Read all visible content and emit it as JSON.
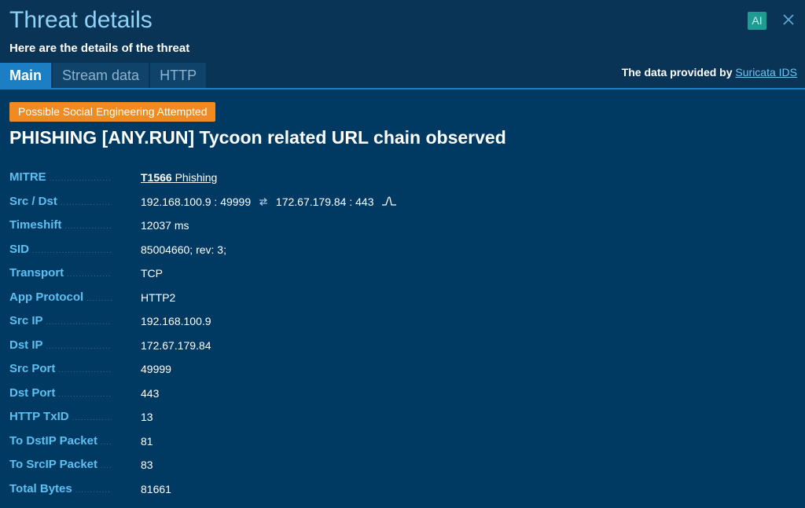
{
  "dialog": {
    "title": "Threat details",
    "subtitle": "Here are the details of the threat",
    "ai_label": "AI",
    "accent_color": "#1c7fc4",
    "header_color": "#8fd2f6"
  },
  "tabs": [
    {
      "label": "Main",
      "active": true
    },
    {
      "label": "Stream data",
      "active": false
    },
    {
      "label": "HTTP",
      "active": false
    }
  ],
  "provider": {
    "prefix": "The data provided by",
    "link": "Suricata IDS"
  },
  "threat": {
    "category_badge": "Possible Social Engineering Attempted",
    "badge_color": "#f18b1f",
    "name": "PHISHING [ANY.RUN] Tycoon related URL chain observed"
  },
  "details": {
    "mitre": {
      "label": "MITRE",
      "id": "T1566",
      "name": "Phishing"
    },
    "src_dst": {
      "label": "Src / Dst",
      "src": "192.168.100.9 : 49999",
      "dst": "172.67.179.84 : 443",
      "swap_icon": "swap-arrows-icon",
      "signal_icon": "signal-pulse-icon"
    },
    "timeshift": {
      "label": "Timeshift",
      "value": "12037 ms"
    },
    "sid": {
      "label": "SID",
      "value": "85004660; rev: 3;"
    },
    "transport": {
      "label": "Transport",
      "value": "TCP"
    },
    "app_protocol": {
      "label": "App Protocol",
      "value": "HTTP2"
    },
    "src_ip": {
      "label": "Src IP",
      "value": "192.168.100.9"
    },
    "dst_ip": {
      "label": "Dst IP",
      "value": "172.67.179.84"
    },
    "src_port": {
      "label": "Src Port",
      "value": "49999"
    },
    "dst_port": {
      "label": "Dst Port",
      "value": "443"
    },
    "http_txid": {
      "label": "HTTP TxID",
      "value": "13"
    },
    "to_dstip_packet": {
      "label": "To DstIP Packet",
      "value": "81"
    },
    "to_srcip_packet": {
      "label": "To SrcIP Packet",
      "value": "83"
    },
    "total_bytes": {
      "label": "Total Bytes",
      "value": "81661"
    }
  }
}
